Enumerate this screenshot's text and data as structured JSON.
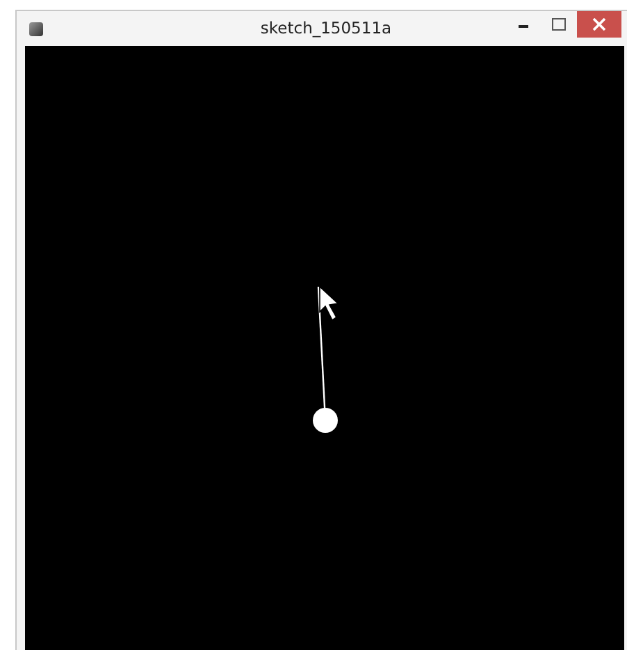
{
  "window": {
    "title": "sketch_150511a"
  }
}
